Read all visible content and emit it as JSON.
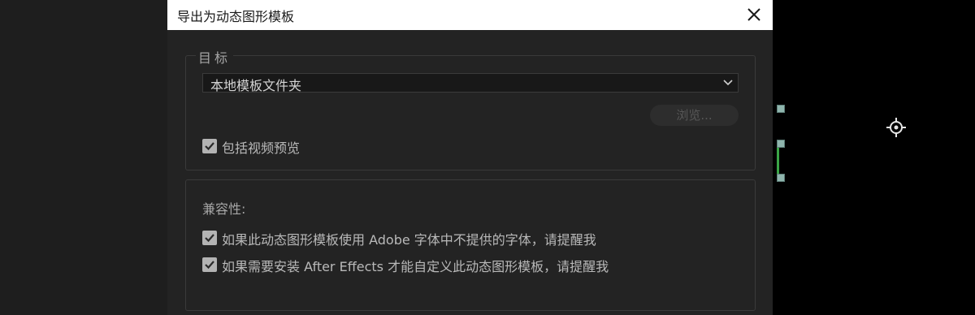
{
  "dialog": {
    "title": "导出为动态图形模板",
    "target": {
      "legend": "目标",
      "select_value": "本地模板文件夹",
      "browse_label": "浏览...",
      "include_preview_label": "包括视频预览",
      "include_preview_checked": true
    },
    "compat": {
      "heading": "兼容性:",
      "warn_fonts_label": "如果此动态图形模板使用 Adobe 字体中不提供的字体，请提醒我",
      "warn_fonts_checked": true,
      "warn_ae_label": "如果需要安装 After Effects 才能自定义此动态图形模板，请提醒我",
      "warn_ae_checked": true
    }
  },
  "icons": {
    "close": "close-icon",
    "chevron": "chevron-down-icon",
    "checkmark": "checkmark-icon",
    "anchor": "anchor-point-icon"
  },
  "colors": {
    "dialog_bg": "#232323",
    "titlebar_bg": "#ffffff",
    "handle": "#8fb5ad",
    "path_line": "#3aa547"
  }
}
